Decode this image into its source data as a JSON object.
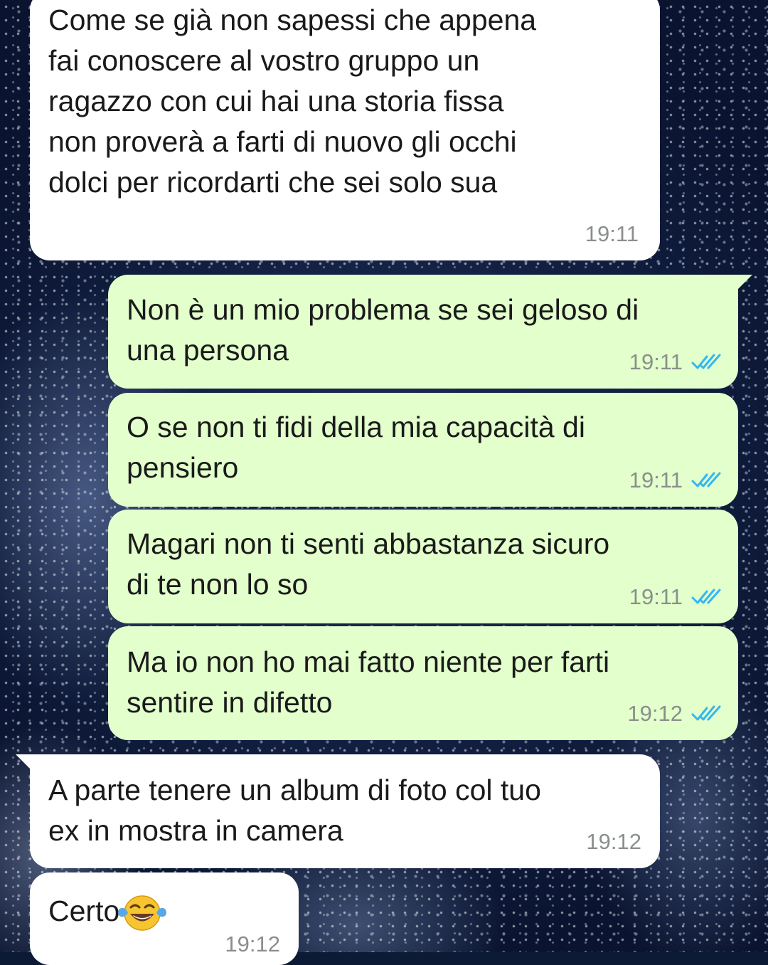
{
  "messages": [
    {
      "direction": "incoming",
      "text": "Come se già non sapessi che appena\nfai conoscere al vostro gruppo un\nragazzo con cui hai una storia fissa\nnon proverà a farti di nuovo gli occhi\ndolci per ricordarti che sei solo sua",
      "time": "19:11"
    },
    {
      "direction": "outgoing",
      "text": "Non è un mio problema se sei geloso di\nuna persona",
      "time": "19:11",
      "status": "read"
    },
    {
      "direction": "outgoing",
      "text": "O se non ti fidi della mia capacità di\npensiero",
      "time": "19:11",
      "status": "read"
    },
    {
      "direction": "outgoing",
      "text": "Magari non ti senti abbastanza sicuro\ndi te non lo so",
      "time": "19:11",
      "status": "read"
    },
    {
      "direction": "outgoing",
      "text": "Ma io non ho mai fatto niente per farti\nsentire in difetto",
      "time": "19:12",
      "status": "read"
    },
    {
      "direction": "incoming",
      "text": "A parte tenere un album di foto col tuo\nex in mostra in camera",
      "time": "19:12"
    },
    {
      "direction": "incoming",
      "text": "Certo",
      "emoji": "face-with-tears-of-joy-icon",
      "time": "19:12"
    }
  ],
  "colors": {
    "incoming_bubble": "#ffffff",
    "outgoing_bubble": "#e2ffcc",
    "timestamp": "#8a8f8c",
    "read_ticks": "#34b7f1"
  }
}
